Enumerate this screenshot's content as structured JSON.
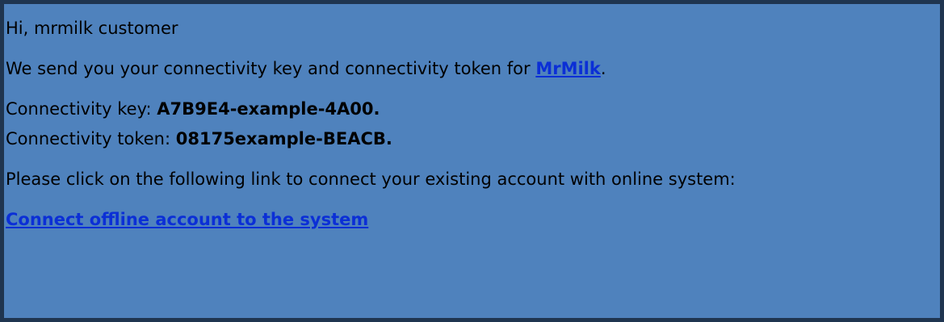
{
  "email": {
    "greeting": "Hi, mrmilk customer",
    "intro_text": "We send you your connectivity key and connectivity token for ",
    "brand_link": "MrMilk",
    "intro_end": ".",
    "key_label": "Connectivity key: ",
    "key_value": "A7B9E4-example-4A00.",
    "token_label": "Connectivity token: ",
    "token_value": "08175example-BEACB.",
    "instruction": "Please click on the following link to connect your existing account with online system:",
    "connect_link": "Connect offline account to the system"
  },
  "colors": {
    "background": "#4f82bd",
    "border": "#1f3550",
    "link": "#0b2fd6"
  }
}
